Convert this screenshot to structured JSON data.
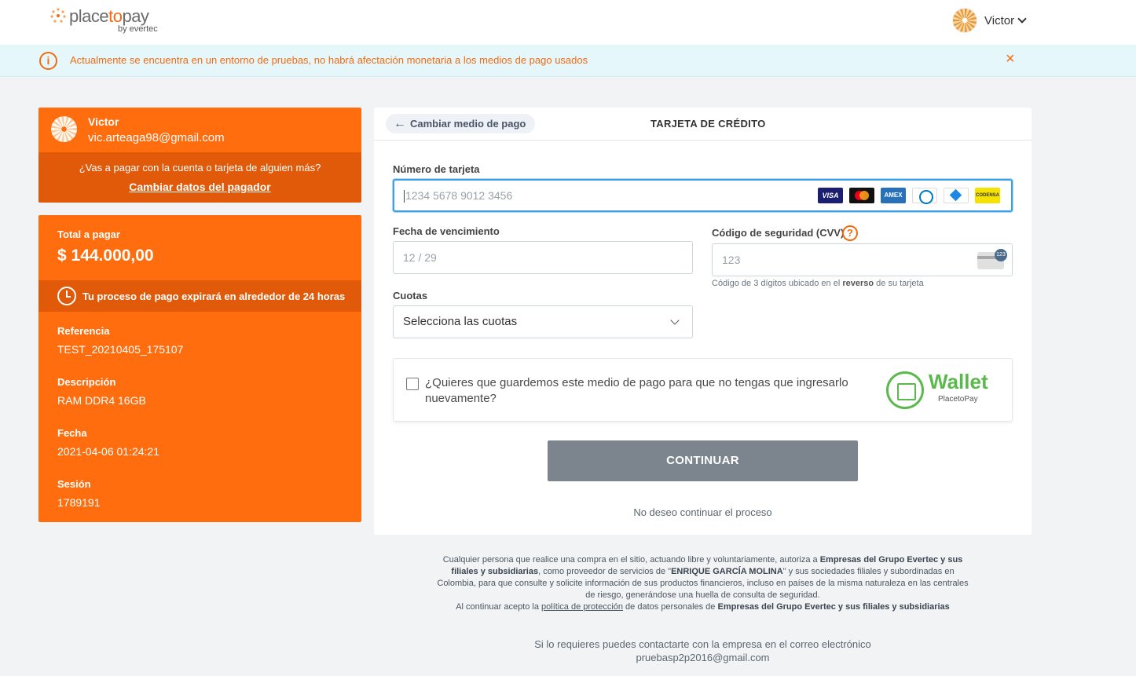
{
  "header": {
    "logo_main_a": "place",
    "logo_main_b": "to",
    "logo_main_c": "pay",
    "logo_sub": "by evertec",
    "user_name": "Victor"
  },
  "alert": {
    "icon": "i",
    "text": "Actualmente se encuentra en un entorno de pruebas, no habrá afectación monetaria a los medios de pago usados",
    "close": "×"
  },
  "payer": {
    "name": "Victor",
    "email": "vic.arteaga98@gmail.com",
    "question": "¿Vas a pagar con la cuenta o tarjeta de alguien más?",
    "change_link": "Cambiar datos del pagador"
  },
  "summary": {
    "total_label": "Total a pagar",
    "total_value": "$ 144.000,00",
    "expire_text": "Tu proceso de pago expirará en alrededor de 24 horas",
    "reference_label": "Referencia",
    "reference_value": "TEST_20210405_175107",
    "description_label": "Descripción",
    "description_value": "RAM DDR4 16GB",
    "date_label": "Fecha",
    "date_value": "2021-04-06 01:24:21",
    "session_label": "Sesión",
    "session_value": "1789191"
  },
  "form": {
    "back_label": "Cambiar medio de pago",
    "title": "TARJETA DE CRÉDITO",
    "card_number_label": "Número de tarjeta",
    "card_number_placeholder": "1234 5678 9012 3456",
    "brands": [
      "VISA",
      "",
      "AMEX",
      "",
      "",
      "CODENSA"
    ],
    "expiry_label": "Fecha de vencimiento",
    "expiry_placeholder": "12 / 29",
    "cvv_label": "Código de seguridad (CVV)",
    "cvv_help": "?",
    "cvv_placeholder": "123",
    "cvv_badge": "123",
    "cvv_hint_a": "Código de 3 dígitos ubicado en el ",
    "cvv_hint_b": "reverso",
    "cvv_hint_c": " de su tarjeta",
    "installments_label": "Cuotas",
    "installments_value": "Selecciona las cuotas",
    "save_question": "¿Quieres que guardemos este medio de pago para que no tengas que ingresarlo nuevamente?",
    "wallet_title": "Wallet",
    "wallet_sub": "PlacetoPay",
    "continue_label": "CONTINUAR",
    "cancel_label": "No deseo continuar el proceso"
  },
  "legal": {
    "p1": "Cualquier persona que realice una compra en el sitio, actuando libre y voluntariamente, autoriza a ",
    "p1_b": "Empresas del Grupo Evertec y sus filiales y subsidiarias",
    "p2": ", como proveedor de servicios de \"",
    "p2_b": "ENRIQUE GARCÍA MOLINA",
    "p3": "\" y sus sociedades filiales y subordinadas en Colombia, para que consulte y solicite información de sus productos financieros, incluso en países de la misma naturaleza en las centrales de riesgo, generándose una huella de consulta de seguridad.",
    "p4": "Al continuar acepto la ",
    "p4_link": "política de protección",
    "p5": " de datos personales de ",
    "p5_b": "Empresas del Grupo Evertec y sus filiales y subsidiarias"
  },
  "contact": {
    "line1": "Si lo requieres puedes contactarte con la empresa en el correo electrónico",
    "email": "pruebasp2p2016@gmail.com"
  },
  "colors": {
    "brand_orange": "#ff6d0e",
    "dark_orange": "#e05a0a",
    "alert_bg": "#e5f7fb",
    "button_gray": "#7c858e",
    "focus_blue": "#3aa0e8",
    "wallet_green": "#5bb84c"
  },
  "icons": {
    "alert": "info-circle-icon",
    "close": "close-icon",
    "user_chevron": "chevron-down-icon",
    "back": "arrow-left-icon",
    "clock": "clock-icon",
    "cvv_card": "card-back-icon",
    "select": "chevron-down-icon",
    "wallet": "wallet-icon"
  }
}
